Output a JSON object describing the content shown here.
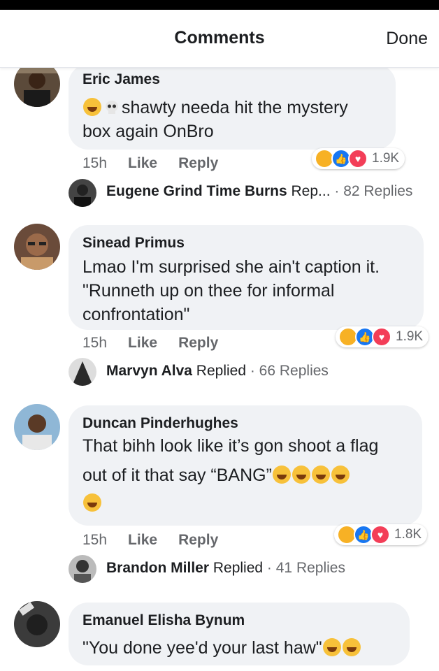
{
  "header": {
    "title": "Comments",
    "done": "Done"
  },
  "comments": [
    {
      "author": "Eric James",
      "lines": [
        "shawty needa hit the mystery",
        "box again OnBro"
      ],
      "time": "15h",
      "like": "Like",
      "reply": "Reply",
      "reactions_count": "1.9K",
      "reply_preview": {
        "name": "Eugene Grind Time Burns",
        "status": "Rep...",
        "count": "· 82 Replies"
      }
    },
    {
      "author": "Sinead Primus",
      "lines": [
        "Lmao I'm surprised she ain't caption it.",
        "\"Runneth up on thee for informal",
        "confrontation\""
      ],
      "time": "15h",
      "like": "Like",
      "reply": "Reply",
      "reactions_count": "1.9K",
      "reply_preview": {
        "name": "Marvyn Alva",
        "status": "Replied",
        "count": "· 66 Replies"
      }
    },
    {
      "author": "Duncan Pinderhughes",
      "lines": [
        "That bihh look like it’s gon shoot a flag",
        "out of it that say “BANG”"
      ],
      "time": "15h",
      "like": "Like",
      "reply": "Reply",
      "reactions_count": "1.8K",
      "reply_preview": {
        "name": "Brandon Miller",
        "status": "Replied",
        "count": "· 41 Replies"
      }
    },
    {
      "author": "Emanuel Elisha Bynum",
      "lines": [
        "\"You done yee'd your last haw\""
      ]
    }
  ],
  "icons": {
    "laugh": "laugh-react-icon",
    "like": "like-react-icon",
    "love": "love-react-icon",
    "skull": "skull-emoji-icon"
  },
  "colors": {
    "bubble": "#f0f2f5",
    "like_blue": "#1877f2",
    "love_red": "#f33e58",
    "laugh_yellow": "#f7b125"
  }
}
